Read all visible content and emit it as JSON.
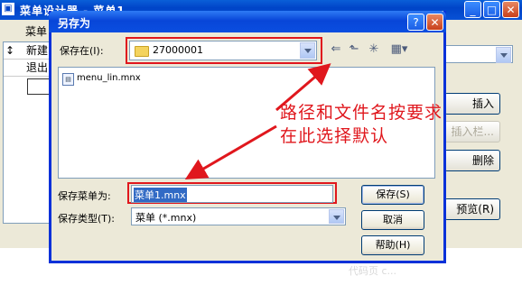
{
  "background_window": {
    "title": "菜单设计器 - 菜单1",
    "column_label": "菜单",
    "list_items": [
      "新建",
      "退出"
    ],
    "buttons": {
      "insert": "插入",
      "insert_bar": "插入栏...",
      "delete": "删除",
      "preview": "预览(R)"
    }
  },
  "dialog": {
    "title": "另存为",
    "save_in_label": "保存在(I):",
    "save_in_value": "27000001",
    "files": [
      "menu_lin.mnx"
    ],
    "filename_label": "保存菜单为:",
    "filename_value": "菜单1.mnx",
    "filetype_label": "保存类型(T):",
    "filetype_value": "菜单 (*.mnx)",
    "buttons": {
      "save": "保存(S)",
      "cancel": "取消",
      "help": "帮助(H)"
    }
  },
  "annotation": {
    "line1": "路径和文件名按要求",
    "line2": "在此选择默认"
  },
  "watermark": "代码页 c...",
  "colors": {
    "annotation_red": "#e0171d",
    "title_blue": "#0846d8",
    "xp_face": "#ece9d8"
  }
}
